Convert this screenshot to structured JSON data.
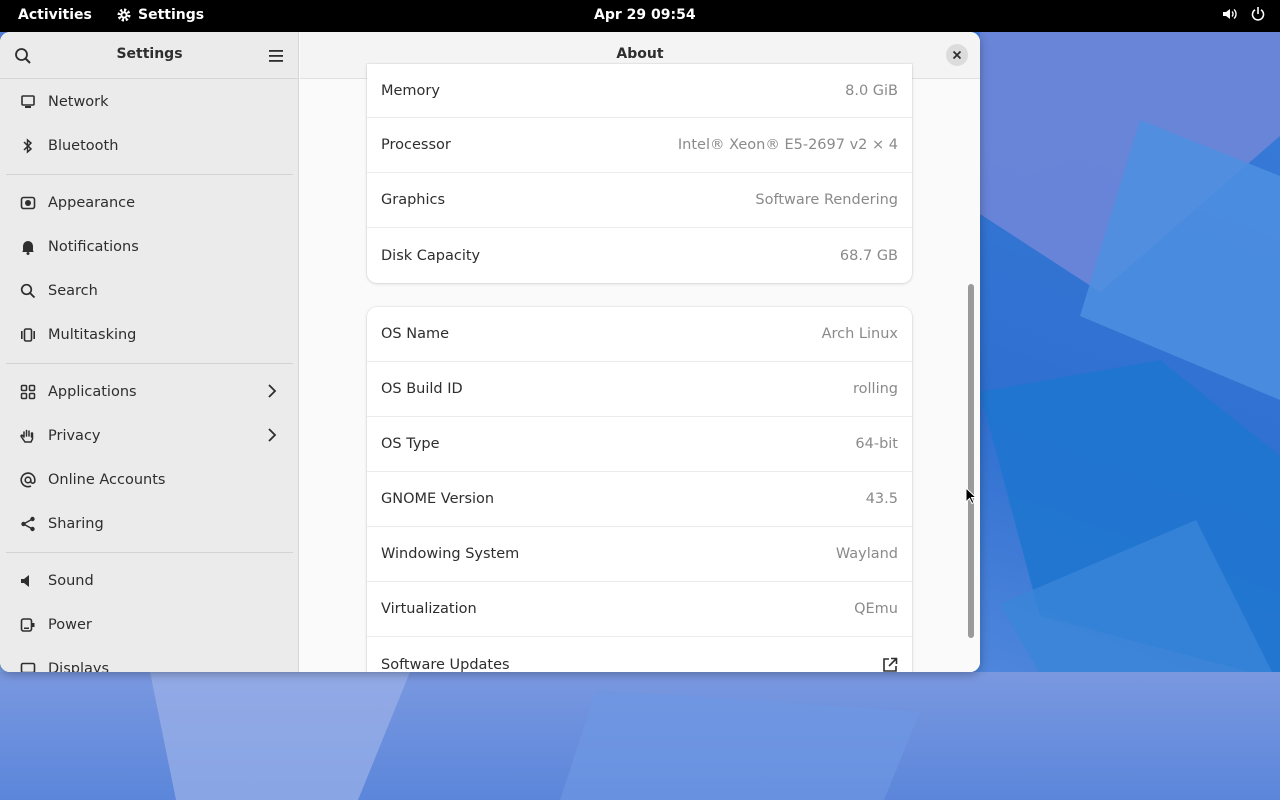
{
  "topbar": {
    "activities": "Activities",
    "app_name": "Settings",
    "clock": "Apr 29  09:54"
  },
  "sidebar": {
    "title": "Settings",
    "groups": [
      [
        {
          "label": "Network",
          "icon": "network-icon"
        },
        {
          "label": "Bluetooth",
          "icon": "bluetooth-icon"
        }
      ],
      [
        {
          "label": "Appearance",
          "icon": "appearance-icon"
        },
        {
          "label": "Notifications",
          "icon": "bell-icon"
        },
        {
          "label": "Search",
          "icon": "search-icon"
        },
        {
          "label": "Multitasking",
          "icon": "multitasking-icon"
        }
      ],
      [
        {
          "label": "Applications",
          "icon": "grid-icon",
          "has_arrow": true
        },
        {
          "label": "Privacy",
          "icon": "hand-icon",
          "has_arrow": true
        },
        {
          "label": "Online Accounts",
          "icon": "at-icon"
        },
        {
          "label": "Sharing",
          "icon": "share-icon"
        }
      ],
      [
        {
          "label": "Sound",
          "icon": "speaker-icon"
        },
        {
          "label": "Power",
          "icon": "power-plug-icon"
        },
        {
          "label": "Displays",
          "icon": "display-icon"
        }
      ]
    ]
  },
  "main": {
    "title": "About",
    "hardware": [
      {
        "label": "Memory",
        "value": "8.0 GiB"
      },
      {
        "label": "Processor",
        "value": "Intel® Xeon® E5-2697 v2 × 4"
      },
      {
        "label": "Graphics",
        "value": "Software Rendering"
      },
      {
        "label": "Disk Capacity",
        "value": "68.7 GB"
      }
    ],
    "software": [
      {
        "label": "OS Name",
        "value": "Arch Linux"
      },
      {
        "label": "OS Build ID",
        "value": "rolling"
      },
      {
        "label": "OS Type",
        "value": "64-bit"
      },
      {
        "label": "GNOME Version",
        "value": "43.5"
      },
      {
        "label": "Windowing System",
        "value": "Wayland"
      },
      {
        "label": "Virtualization",
        "value": "QEmu"
      },
      {
        "label": "Software Updates",
        "value": ""
      }
    ]
  }
}
